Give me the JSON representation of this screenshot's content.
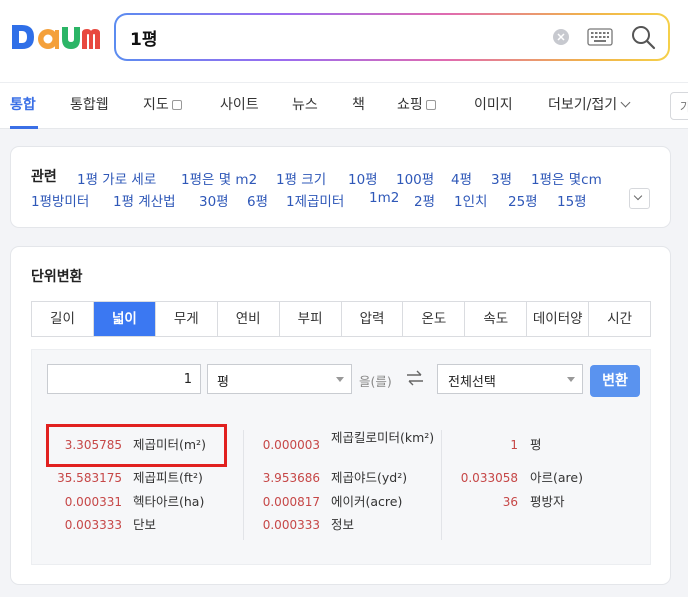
{
  "search": {
    "query": "1평"
  },
  "nav": {
    "tabs": [
      "통합",
      "통합웹",
      "지도",
      "사이트",
      "뉴스",
      "책",
      "쇼핑",
      "이미지",
      "더보기/접기"
    ],
    "cut_box": "가"
  },
  "related": {
    "title": "관련",
    "links": [
      "1평 가로 세로",
      "1평은 몇 m2",
      "1평 크기",
      "10평",
      "100평",
      "4평",
      "3평",
      "1평은 몇cm",
      "1평방미터",
      "1평 계산법",
      "30평",
      "6평",
      "1제곱미터",
      "1m2",
      "2평",
      "1인치",
      "25평",
      "15평"
    ]
  },
  "converter": {
    "title": "단위변환",
    "tabs": [
      "길이",
      "넓이",
      "무게",
      "연비",
      "부피",
      "압력",
      "온도",
      "속도",
      "데이터양",
      "시간"
    ],
    "active_tab": "넓이",
    "input_value": "1",
    "from_unit": "평",
    "particle": "을(를)",
    "to_unit": "전체선택",
    "convert_label": "변환",
    "results": [
      {
        "value": "3.305785",
        "unit": "제곱미터(m²)"
      },
      {
        "value": "35.583175",
        "unit": "제곱피트(ft²)"
      },
      {
        "value": "0.000331",
        "unit": "헥타아르(ha)"
      },
      {
        "value": "0.003333",
        "unit": "단보"
      },
      {
        "value": "0.000003",
        "unit": "제곱킬로미터(km²)"
      },
      {
        "value": "3.953686",
        "unit": "제곱야드(yd²)"
      },
      {
        "value": "0.000817",
        "unit": "에이커(acre)"
      },
      {
        "value": "0.000333",
        "unit": "정보"
      },
      {
        "value": "1",
        "unit": "평"
      },
      {
        "value": "0.033058",
        "unit": "아르(are)"
      },
      {
        "value": "36",
        "unit": "평방자"
      }
    ]
  },
  "colors": {
    "accent": "#3b78f2",
    "result_value": "#c64747",
    "highlight": "#e1201f",
    "link": "#2f58b8"
  }
}
